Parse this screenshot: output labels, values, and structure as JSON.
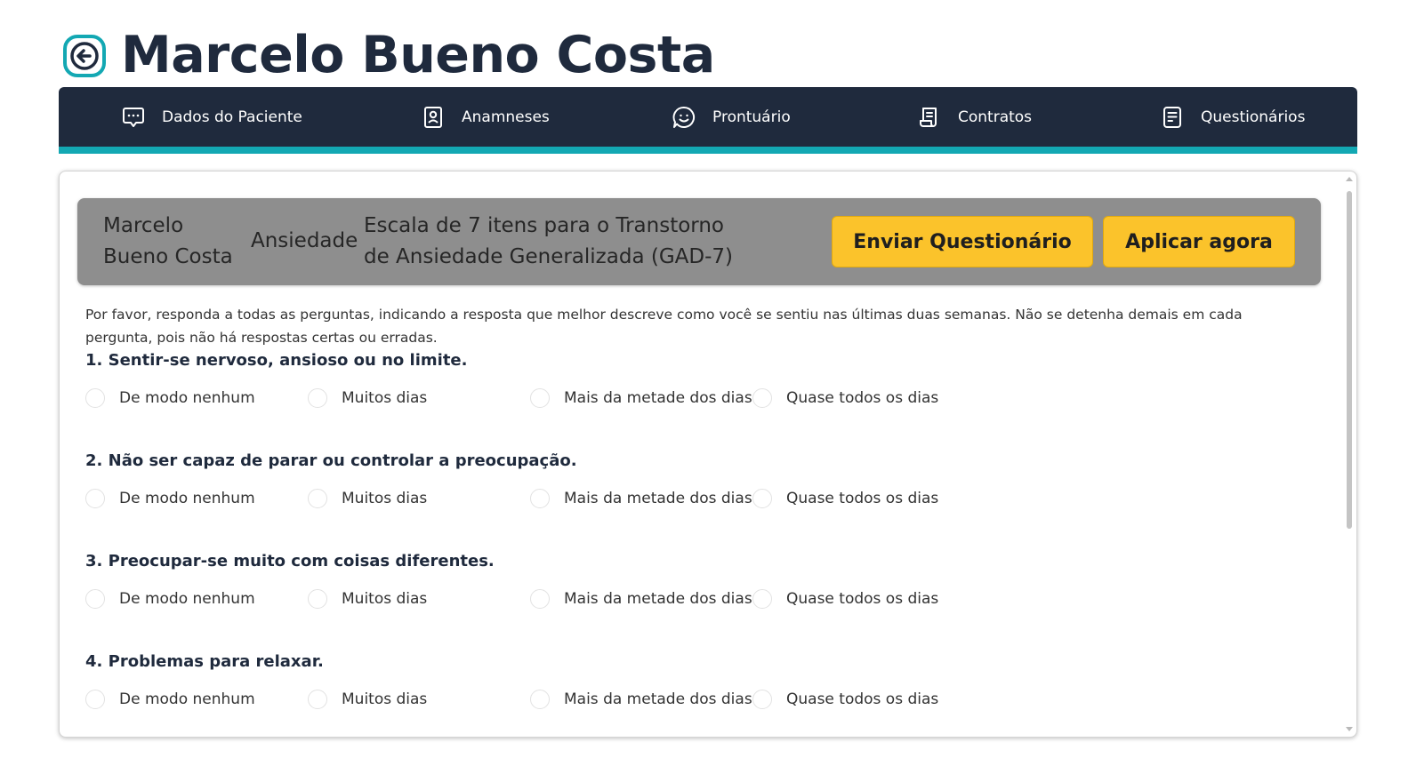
{
  "header": {
    "title": "Marcelo Bueno Costa",
    "back_icon": "arrow-left-circle-icon"
  },
  "nav": {
    "accent_color": "#13a8b3",
    "background_color": "#1f2a3d",
    "items": [
      {
        "label": "Dados do Paciente",
        "icon": "chat-dots-icon"
      },
      {
        "label": "Anamneses",
        "icon": "id-card-icon"
      },
      {
        "label": "Prontuário",
        "icon": "smile-chat-icon"
      },
      {
        "label": "Contratos",
        "icon": "contract-icon"
      },
      {
        "label": "Questionários",
        "icon": "document-icon"
      }
    ]
  },
  "questionnaire": {
    "patient_name": "Marcelo Bueno Costa",
    "category": "Ansiedade",
    "scale_name": "Escala de 7 itens para o Transtorno de Ansiedade Generalizada (GAD-7)",
    "send_button": "Enviar Questionário",
    "apply_button": "Aplicar agora",
    "button_color": "#fbc32b",
    "instructions": "Por favor, responda a todas as perguntas, indicando a resposta que melhor descreve como você se sentiu nas últimas duas semanas. Não se detenha demais em cada pergunta, pois não há respostas certas ou erradas.",
    "options": [
      "De modo nenhum",
      "Muitos dias",
      "Mais da metade dos dias",
      "Quase todos os dias"
    ],
    "questions": [
      {
        "title": "1. Sentir-se nervoso, ansioso ou no limite."
      },
      {
        "title": "2. Não ser capaz de parar ou controlar a preocupação."
      },
      {
        "title": "3. Preocupar-se muito com coisas diferentes."
      },
      {
        "title": "4. Problemas para relaxar."
      }
    ]
  }
}
